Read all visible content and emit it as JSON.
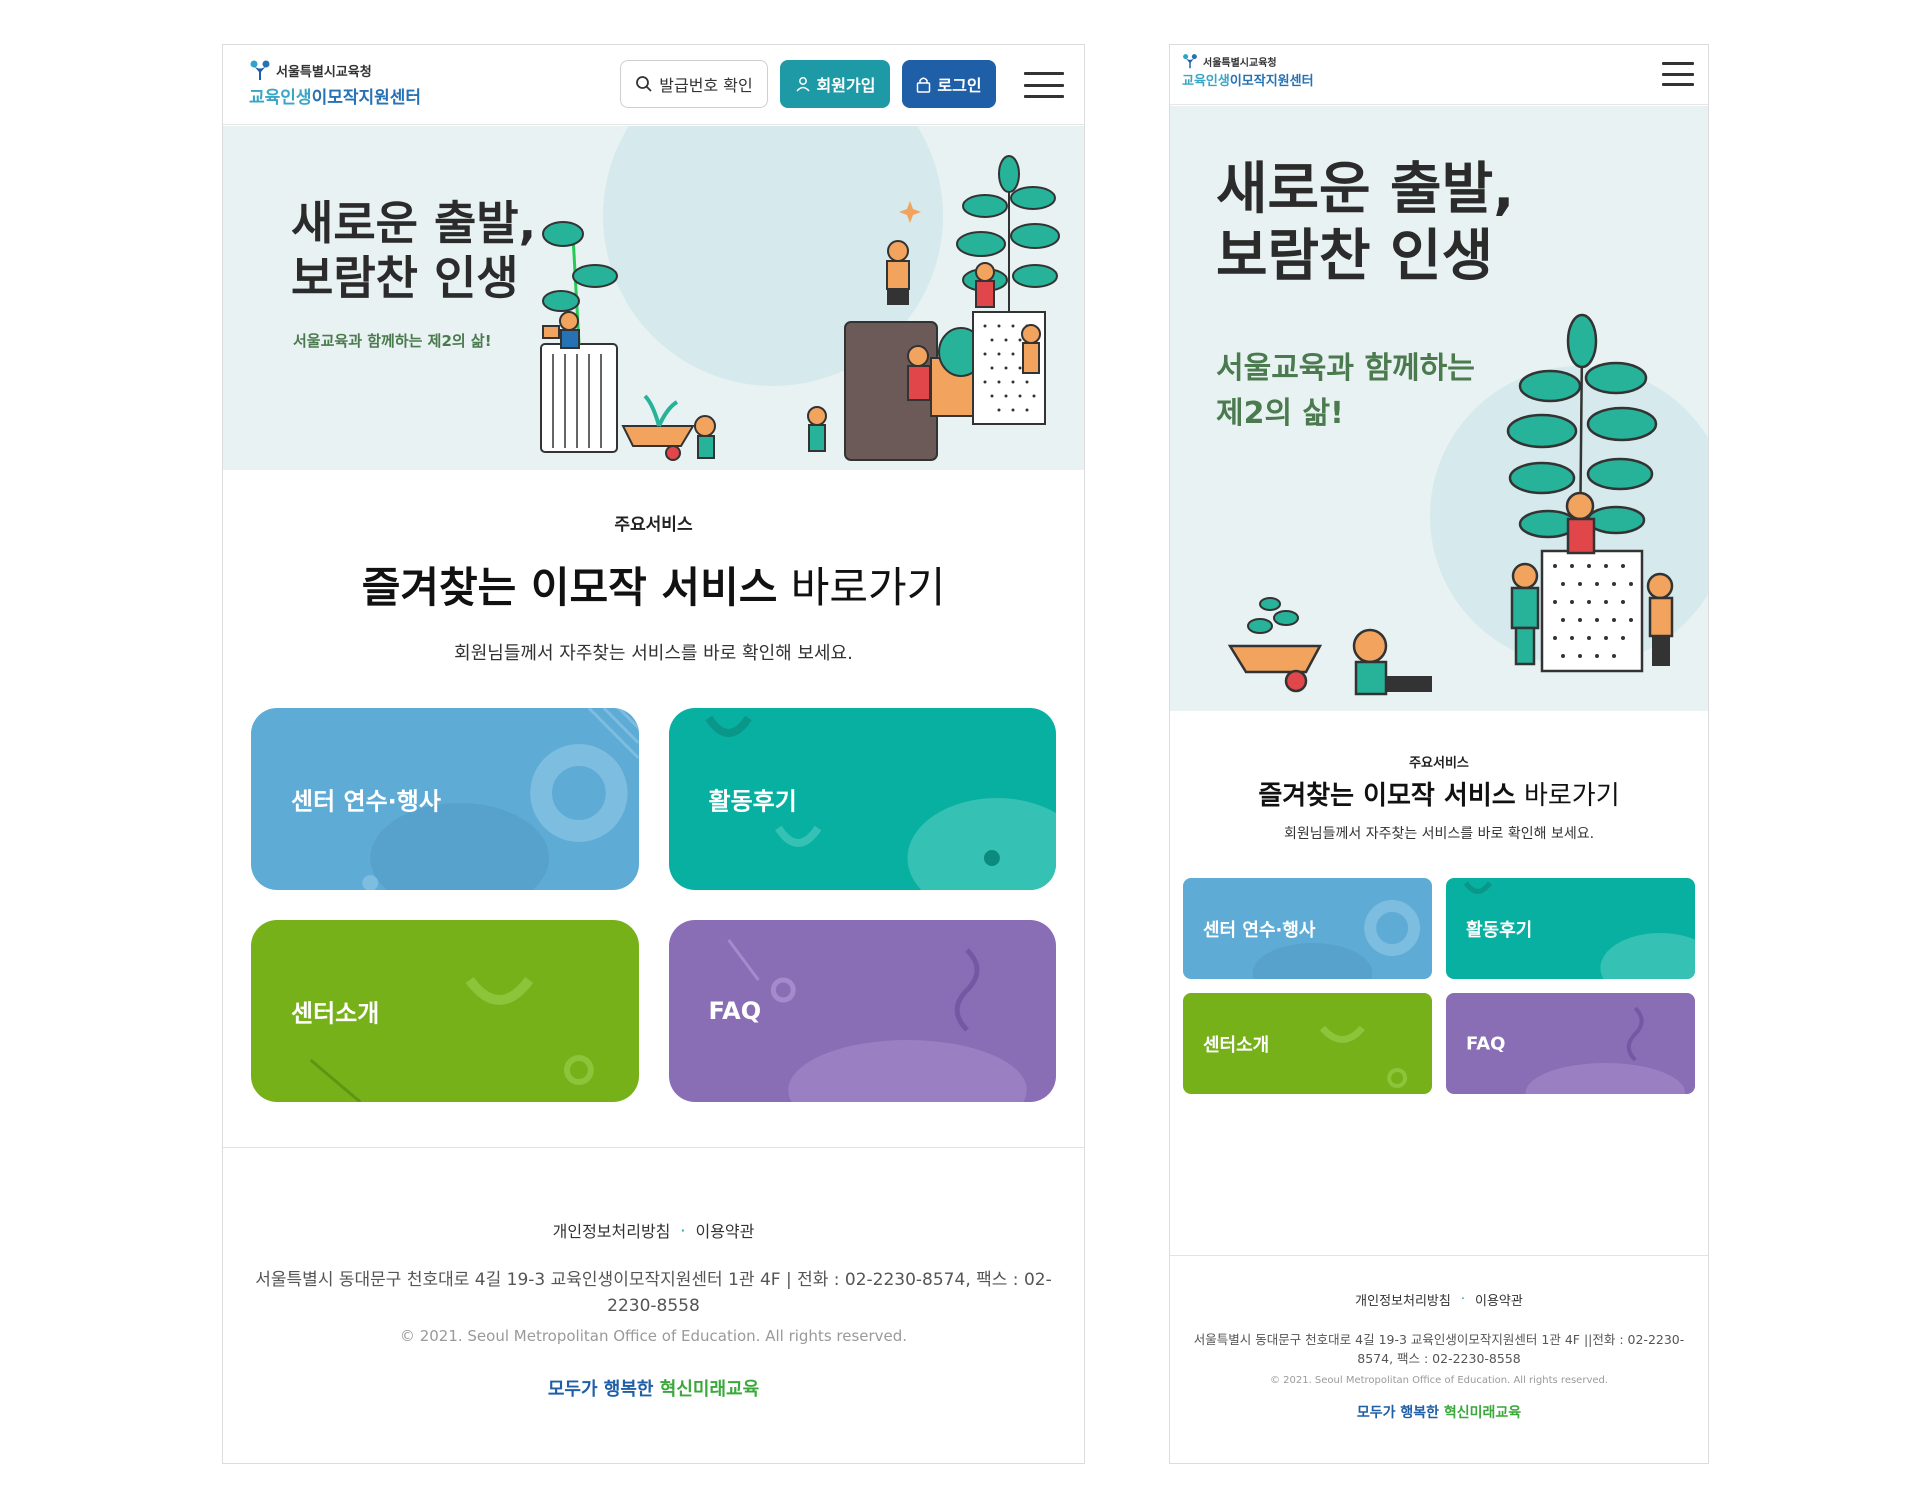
{
  "brand": {
    "org": "서울특별시교육청",
    "name_part1": "교육인생",
    "name_part2": "이모작지원센터"
  },
  "header": {
    "issue_check": "발급번호 확인",
    "signup": "회원가입",
    "login": "로그인"
  },
  "hero": {
    "title_line1": "새로운 출발,",
    "title_line2": "보람찬 인생",
    "subtitle": "서울교육과 함께하는 제2의 삶!",
    "subtitle_line1": "서울교육과 함께하는",
    "subtitle_line2": "제2의 삶!"
  },
  "services": {
    "kicker": "주요서비스",
    "title_bold": "즐겨찾는 이모작 서비스",
    "title_light": "바로가기",
    "description": "회원님들께서 자주찾는 서비스를 바로 확인해 보세요.",
    "cards": [
      {
        "label": "센터 연수·행사",
        "color": "#5eabd6"
      },
      {
        "label": "활동후기",
        "color": "#07b0a0"
      },
      {
        "label": "센터소개",
        "color": "#76b11a"
      },
      {
        "label": "FAQ",
        "color": "#8a6eb5"
      }
    ]
  },
  "footer": {
    "privacy": "개인정보처리방침",
    "terms": "이용약관",
    "address": "서울특별시 동대문구 천호대로 4길 19-3 교육인생이모작지원센터 1관 4F | 전화 : 02-2230-8574, 팩스 : 02-2230-8558",
    "address_mobile": "서울특별시 동대문구 천호대로 4길 19-3 교육인생이모작지원센터 1관 4F ||전화 : 02-2230-8574, 팩스 : 02-2230-8558",
    "copyright": "© 2021. Seoul Metropolitan Office of Education. All rights reserved.",
    "slogan_part1": "모두가 행복한",
    "slogan_part2": "혁신미래교육"
  },
  "icons": {
    "search": "search-icon",
    "user": "user-icon",
    "lock": "lock-icon",
    "menu": "hamburger-icon"
  }
}
